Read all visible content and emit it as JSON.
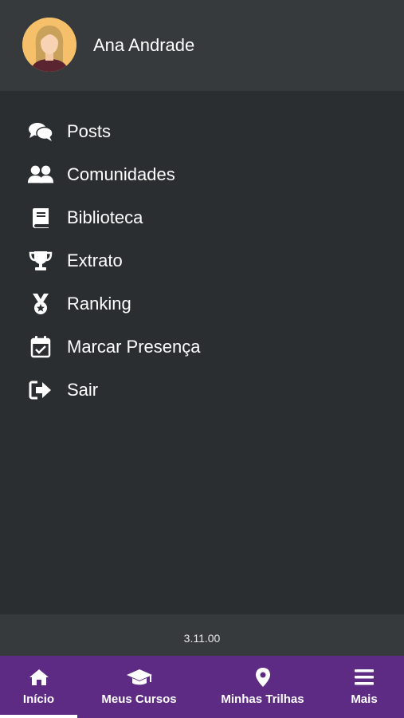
{
  "user": {
    "name": "Ana Andrade"
  },
  "menu": {
    "items": [
      {
        "label": "Posts",
        "icon": "comments-icon"
      },
      {
        "label": "Comunidades",
        "icon": "users-icon"
      },
      {
        "label": "Biblioteca",
        "icon": "book-icon"
      },
      {
        "label": "Extrato",
        "icon": "trophy-icon"
      },
      {
        "label": "Ranking",
        "icon": "medal-icon"
      },
      {
        "label": "Marcar Presença",
        "icon": "calendar-check-icon"
      },
      {
        "label": "Sair",
        "icon": "sign-out-icon"
      }
    ]
  },
  "app": {
    "version": "3.11.00"
  },
  "bottom_nav": {
    "active": "Início",
    "items": [
      {
        "label": "Início",
        "icon": "home-icon"
      },
      {
        "label": "Meus Cursos",
        "icon": "graduation-cap-icon"
      },
      {
        "label": "Minhas Trilhas",
        "icon": "map-marker-icon"
      },
      {
        "label": "Mais",
        "icon": "menu-icon"
      }
    ]
  },
  "colors": {
    "header_bg": "#363a3c",
    "drawer_bg": "#2b2e30",
    "nav_bg": "#5e2b84",
    "text": "#ffffff"
  }
}
